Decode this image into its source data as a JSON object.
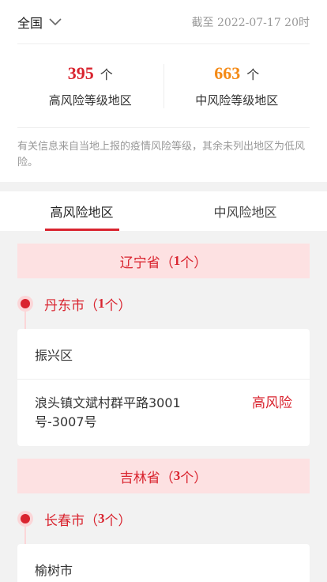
{
  "header": {
    "region": "全国",
    "cutoff": "截至 2022-07-17 20时"
  },
  "stats": {
    "high": {
      "count": "395",
      "unit": "个",
      "label": "高风险等级地区"
    },
    "mid": {
      "count": "663",
      "unit": "个",
      "label": "中风险等级地区"
    }
  },
  "note": "有关信息来自当地上报的疫情风险等级，其余未列出地区为低风险。",
  "tabs": [
    {
      "label": "高风险地区"
    },
    {
      "label": "中风险地区"
    }
  ],
  "provinces": [
    {
      "name": "辽宁省",
      "paren_open": "（",
      "count": "1",
      "count_unit": "个）",
      "city": {
        "name": "丹东市",
        "paren_open": "（",
        "count": "1",
        "count_unit": "个）"
      },
      "district": "振兴区",
      "area": {
        "name": "浪头镇文斌村群平路3001号-3007号",
        "level": "高风险"
      }
    },
    {
      "name": "吉林省",
      "paren_open": "（",
      "count": "3",
      "count_unit": "个）",
      "city": {
        "name": "长春市",
        "paren_open": "（",
        "count": "3",
        "count_unit": "个）"
      },
      "district": "榆树市"
    }
  ],
  "colors": {
    "accent": "#d9242f",
    "orange": "#f48a16",
    "province_bg": "#fde1e2"
  },
  "icons": {
    "region_chevron": "chevron-down-icon"
  }
}
